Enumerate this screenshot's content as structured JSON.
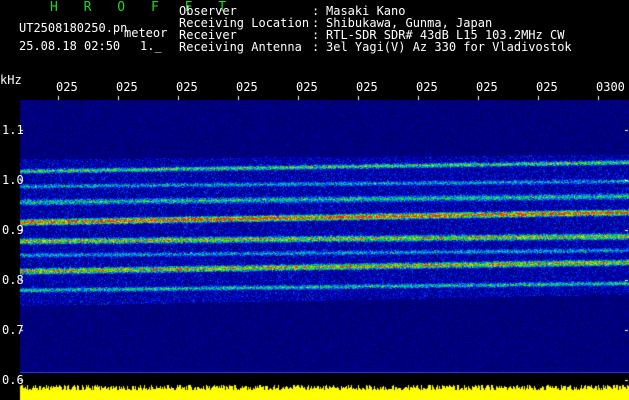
{
  "app": {
    "title": "H R O F F T"
  },
  "file": {
    "name": "UT2508180250.pn",
    "tag": "meteor",
    "timestamp": "25.08.18 02:50",
    "page": "1._"
  },
  "info": [
    {
      "label": "Observer",
      "sep": ":",
      "value": "Masaki Kano"
    },
    {
      "label": "Receiving Location",
      "sep": ":",
      "value": "Shibukawa, Gunma, Japan"
    },
    {
      "label": "Receiver",
      "sep": ":",
      "value": "RTL-SDR SDR# 43dB L15 103.2MHz CW"
    },
    {
      "label": "Receiving Antenna",
      "sep": ":",
      "value": "3el Yagi(V) Az 330 for Vladivostok"
    }
  ],
  "axis": {
    "y_unit": "kHz",
    "y_ticks": [
      "1.1",
      "1.0",
      "0.9",
      "0.8",
      "0.7",
      "0.6"
    ],
    "x_ticks": [
      "025",
      "025",
      "025",
      "025",
      "025",
      "025",
      "025",
      "025",
      "025",
      "0300"
    ]
  },
  "colors": {
    "background": "#000000",
    "plot": "#00006e",
    "title_green": "#1fd81f",
    "signal_yellow": "#ffff00",
    "strong_red": "#ff2a2a"
  }
}
